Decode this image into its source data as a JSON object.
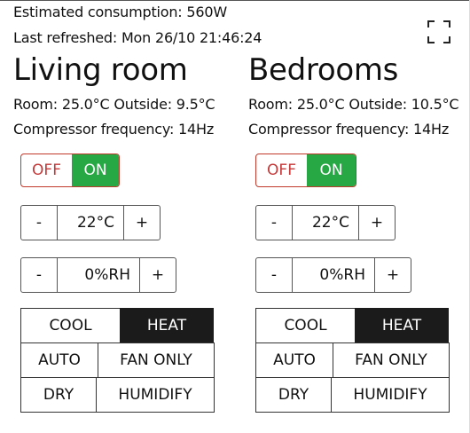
{
  "header": {
    "consumption": "Estimated consumption: 560W",
    "refreshed": "Last refreshed: Mon 26/10 21:46:24"
  },
  "rooms": [
    {
      "name": "Living room",
      "temps": "Room: 25.0°C Outside: 9.5°C",
      "compressor": "Compressor frequency: 14Hz",
      "power": {
        "off": "OFF",
        "on": "ON",
        "state": "ON"
      },
      "temp_stepper": {
        "minus": "-",
        "value": "22°C",
        "plus": "+"
      },
      "humidity_stepper": {
        "minus": "-",
        "value": "0%RH",
        "plus": "+"
      },
      "modes": {
        "cool": "COOL",
        "heat": "HEAT",
        "auto": "AUTO",
        "fan_only": "FAN ONLY",
        "dry": "DRY",
        "humidify": "HUMIDIFY",
        "selected": "HEAT"
      }
    },
    {
      "name": "Bedrooms",
      "temps": "Room: 25.0°C Outside: 10.5°C",
      "compressor": "Compressor frequency: 14Hz",
      "power": {
        "off": "OFF",
        "on": "ON",
        "state": "ON"
      },
      "temp_stepper": {
        "minus": "-",
        "value": "22°C",
        "plus": "+"
      },
      "humidity_stepper": {
        "minus": "-",
        "value": "0%RH",
        "plus": "+"
      },
      "modes": {
        "cool": "COOL",
        "heat": "HEAT",
        "auto": "AUTO",
        "fan_only": "FAN ONLY",
        "dry": "DRY",
        "humidify": "HUMIDIFY",
        "selected": "HEAT"
      }
    }
  ],
  "icons": {
    "fullscreen": "fullscreen-icon"
  },
  "colors": {
    "off_text": "#c43a3a",
    "on_bg": "#27a844",
    "selected_mode_bg": "#1b1b1b"
  }
}
